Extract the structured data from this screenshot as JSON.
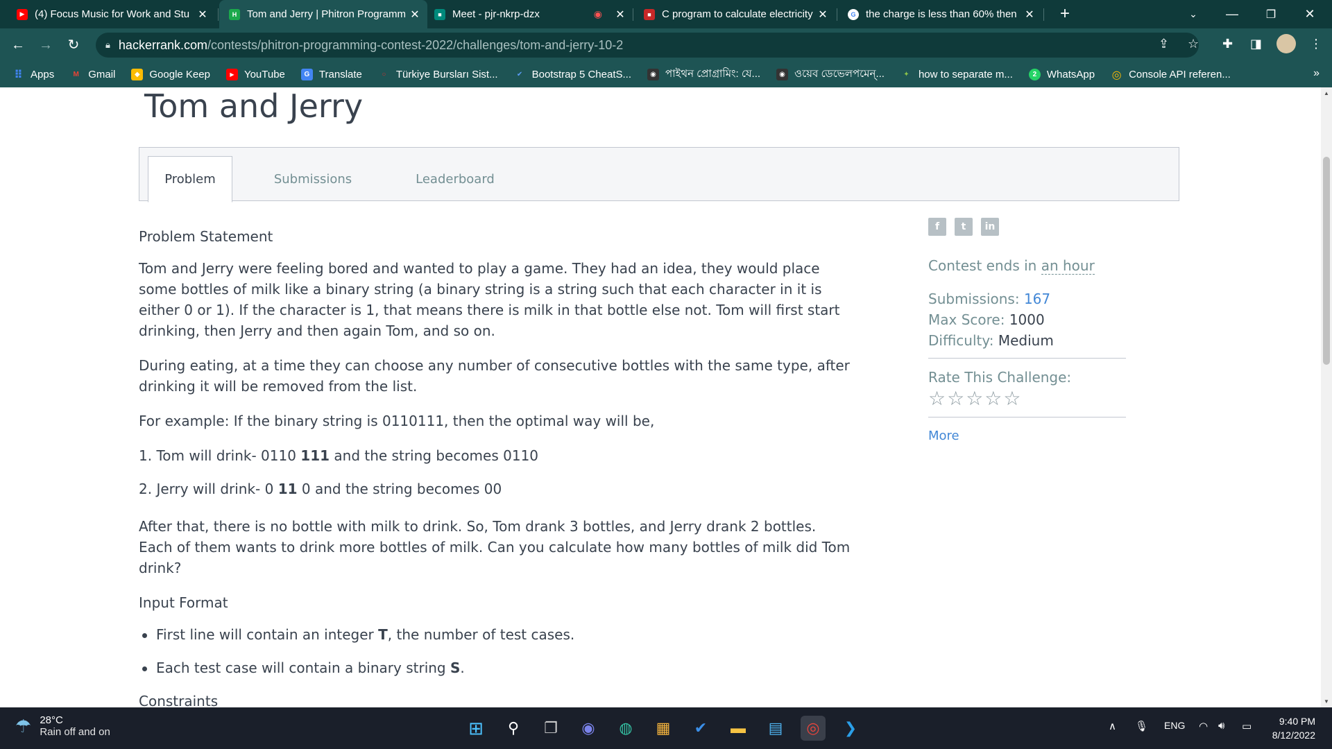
{
  "browser": {
    "tabs": [
      {
        "title": "(4) Focus Music for Work and Stu",
        "icon": "youtube-icon",
        "color": "#ff0000",
        "glyph": "▶"
      },
      {
        "title": "Tom and Jerry | Phitron Programm",
        "icon": "hackerrank-icon",
        "color": "#1ba94c",
        "glyph": "H"
      },
      {
        "title": "Meet - pjr-nkrp-dzx",
        "icon": "google-meet-icon",
        "color": "#00897b",
        "glyph": "■"
      },
      {
        "title": "C program to calculate electricity",
        "icon": "codeforwin-icon",
        "color": "#c62828",
        "glyph": "■"
      },
      {
        "title": "the charge is less than 60% then",
        "icon": "google-icon",
        "color": "#ffffff",
        "glyph": "G"
      }
    ],
    "new_tab": "+",
    "url_host": "hackerrank.com",
    "url_path": "/contests/phitron-programming-contest-2022/challenges/tom-and-jerry-10-2",
    "bookmarks": [
      {
        "label": "Apps",
        "icon": "apps-grid-icon",
        "color": "#4285f4",
        "glyph": "⠿"
      },
      {
        "label": "Gmail",
        "icon": "gmail-icon",
        "color": "#ea4335",
        "glyph": "M"
      },
      {
        "label": "Google Keep",
        "icon": "keep-icon",
        "color": "#fbbc04",
        "glyph": "◆"
      },
      {
        "label": "YouTube",
        "icon": "youtube-icon",
        "color": "#ff0000",
        "glyph": "▶"
      },
      {
        "label": "Translate",
        "icon": "translate-icon",
        "color": "#4285f4",
        "glyph": "G"
      },
      {
        "label": "Türkiye Bursları Sist...",
        "icon": "turkiye-icon",
        "color": "#d32f2f",
        "glyph": "○"
      },
      {
        "label": "Bootstrap 5 CheatS...",
        "icon": "check-icon",
        "color": "#5c9cf5",
        "glyph": "✔"
      },
      {
        "label": "পাইথন প্রোগ্রামিং: যে...",
        "icon": "owl-icon",
        "color": "#333333",
        "glyph": "◉"
      },
      {
        "label": "ওয়েব ডেভেলপমেন্...",
        "icon": "owl-icon",
        "color": "#333333",
        "glyph": "◉"
      },
      {
        "label": "how to separate m...",
        "icon": "sparkle-icon",
        "color": "#8bc34a",
        "glyph": "✦"
      },
      {
        "label": "WhatsApp",
        "icon": "whatsapp-icon",
        "color": "#25d366",
        "glyph": "2"
      },
      {
        "label": "Console API referen...",
        "icon": "chrome-icon",
        "color": "#fbbc04",
        "glyph": "◎"
      }
    ],
    "bookmarks_more": "»"
  },
  "page": {
    "title": "Tom and Jerry",
    "tabs": [
      "Problem",
      "Submissions",
      "Leaderboard"
    ],
    "problem_statement_heading": "Problem Statement",
    "para1": "Tom and Jerry were feeling bored and wanted to play a game. They had an idea, they would place some bottles of milk like a binary string (a binary string is a string such that each character in it is either 0 or 1). If the character is 1, that means there is milk in that bottle else not. Tom will first start drinking, then Jerry and then again Tom, and so on.",
    "para2": "During eating, at a time they can choose any number of consecutive bottles with the same type, after drinking it will be removed from the list.",
    "para3": "For example: If the binary string is 0110111, then the optimal way will be,",
    "step1_pre": "1. Tom will drink- 0110 ",
    "step1_bold": "111",
    "step1_post": " and the string becomes 0110",
    "step2_pre": "2. Jerry will drink- 0 ",
    "step2_bold": "11",
    "step2_post": " 0 and the string becomes 00",
    "para4": "After that, there is no bottle with milk to drink. So, Tom drank 3 bottles, and Jerry drank 2 bottles. Each of them wants to drink more bottles of milk. Can you calculate how many bottles of milk did Tom drink?",
    "input_heading": "Input Format",
    "input1_pre": "First line will contain an integer ",
    "input1_bold": "T",
    "input1_post": ", the number of test cases.",
    "input2_pre": "Each test case will contain a binary string ",
    "input2_bold": "S",
    "input2_post": ".",
    "constraints_heading": "Constraints"
  },
  "sidebar": {
    "contest_ends_label": "Contest ends in ",
    "contest_ends_value": "an hour",
    "submissions_label": "Submissions: ",
    "submissions_value": "167",
    "max_score_label": "Max Score: ",
    "max_score_value": "1000",
    "difficulty_label": "Difficulty: ",
    "difficulty_value": "Medium",
    "rate_label": "Rate This Challenge:",
    "stars": "☆☆☆☆☆",
    "more": "More"
  },
  "taskbar": {
    "temperature": "28°C",
    "weather_text": "Rain off and on",
    "language": "ENG",
    "time": "9:40 PM",
    "date": "8/12/2022"
  }
}
